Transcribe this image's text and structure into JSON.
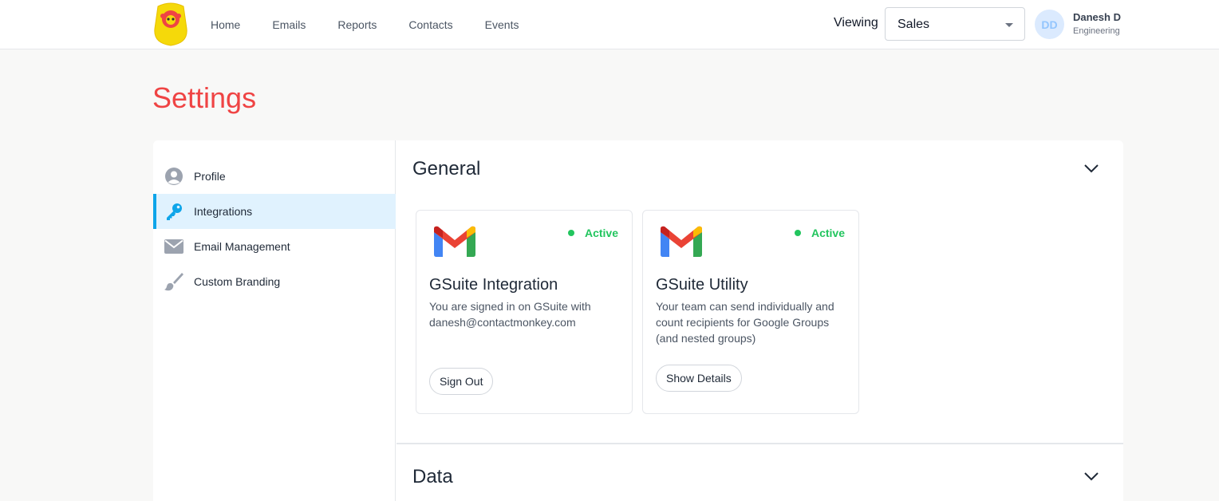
{
  "brand": {
    "logo_text": "contact monkey",
    "logo_color": "#f5d90a"
  },
  "nav": {
    "items": [
      "Home",
      "Emails",
      "Reports",
      "Contacts",
      "Events"
    ]
  },
  "viewing": {
    "label": "Viewing",
    "selected": "Sales"
  },
  "user": {
    "initials": "DD",
    "name": "Danesh D",
    "department": "Engineering"
  },
  "page": {
    "title": "Settings"
  },
  "sidebar": {
    "items": [
      {
        "label": "Profile",
        "icon": "user-circle-icon"
      },
      {
        "label": "Integrations",
        "icon": "key-icon",
        "active": true
      },
      {
        "label": "Email Management",
        "icon": "envelope-icon"
      },
      {
        "label": "Custom Branding",
        "icon": "paintbrush-icon"
      }
    ]
  },
  "sections": {
    "general": {
      "title": "General"
    },
    "data": {
      "title": "Data"
    }
  },
  "cards": [
    {
      "icon": "gmail-icon",
      "status": "Active",
      "title": "GSuite Integration",
      "description": "You are signed in on GSuite with danesh@contactmonkey.com",
      "button": "Sign Out"
    },
    {
      "icon": "gmail-icon",
      "status": "Active",
      "title": "GSuite Utility",
      "description": "Your team can send individually and count recipients for Google Groups (and nested groups)",
      "button": "Show Details"
    }
  ],
  "colors": {
    "accent": "#ef4444",
    "active_status": "#22c55e",
    "selected_nav": "#e0f2fe",
    "selected_border": "#0ea5e9"
  }
}
